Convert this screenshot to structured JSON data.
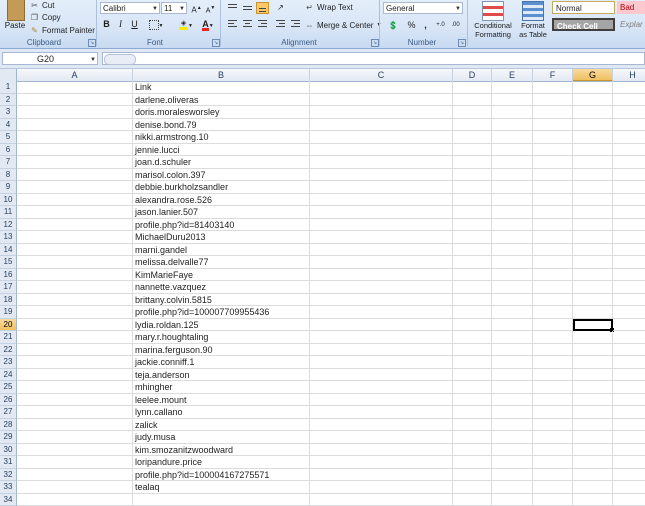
{
  "ribbon": {
    "clipboard": {
      "paste": "Paste",
      "cut": "Cut",
      "copy": "Copy",
      "format_painter": "Format Painter",
      "group_label": "Clipboard"
    },
    "font": {
      "family": "Calibri",
      "size": "11",
      "bold": "B",
      "italic": "I",
      "underline": "U",
      "group_label": "Font"
    },
    "alignment": {
      "wrap_text": "Wrap Text",
      "merge_center": "Merge & Center",
      "group_label": "Alignment"
    },
    "number": {
      "format": "General",
      "percent": "%",
      "comma": ",",
      "group_label": "Number"
    },
    "styles": {
      "conditional_formatting": "Conditional Formatting",
      "format_as_table": "Format as Table",
      "normal": "Normal",
      "bad": "Bad",
      "check_cell": "Check Cell",
      "explanatory": "Explar"
    }
  },
  "formula_bar": {
    "name_box": "G20",
    "formula": ""
  },
  "columns": [
    "A",
    "B",
    "C",
    "D",
    "E",
    "F",
    "G",
    "H"
  ],
  "selected_column": "G",
  "selected_row": 20,
  "rows": [
    {
      "n": "1",
      "b": "Link"
    },
    {
      "n": "2",
      "b": "darlene.oliveras"
    },
    {
      "n": "3",
      "b": "doris.moralesworsley"
    },
    {
      "n": "4",
      "b": "denise.bond.79"
    },
    {
      "n": "5",
      "b": "nikki.armstrong.10"
    },
    {
      "n": "6",
      "b": "jennie.lucci"
    },
    {
      "n": "7",
      "b": "joan.d.schuler"
    },
    {
      "n": "8",
      "b": "marisol.colon.397"
    },
    {
      "n": "9",
      "b": "debbie.burkholzsandler"
    },
    {
      "n": "10",
      "b": "alexandra.rose.526"
    },
    {
      "n": "11",
      "b": "jason.lanier.507"
    },
    {
      "n": "12",
      "b": "profile.php?id=81403140"
    },
    {
      "n": "13",
      "b": "MichaelDuru2013"
    },
    {
      "n": "14",
      "b": "marni.gandel"
    },
    {
      "n": "15",
      "b": "melissa.delvalle77"
    },
    {
      "n": "16",
      "b": "KimMarieFaye"
    },
    {
      "n": "17",
      "b": "nannette.vazquez"
    },
    {
      "n": "18",
      "b": "brittany.colvin.5815"
    },
    {
      "n": "19",
      "b": "profile.php?id=100007709955436"
    },
    {
      "n": "20",
      "b": "lydia.roldan.125"
    },
    {
      "n": "21",
      "b": "mary.r.houghtaling"
    },
    {
      "n": "22",
      "b": "marina.ferguson.90"
    },
    {
      "n": "23",
      "b": "jackie.conniff.1"
    },
    {
      "n": "24",
      "b": "teja.anderson"
    },
    {
      "n": "25",
      "b": "mhingher"
    },
    {
      "n": "26",
      "b": "leelee.mount"
    },
    {
      "n": "27",
      "b": "lynn.callano"
    },
    {
      "n": "28",
      "b": "zalick"
    },
    {
      "n": "29",
      "b": "judy.musa"
    },
    {
      "n": "30",
      "b": "kim.smozanitzwoodward"
    },
    {
      "n": "31",
      "b": "loripandure.price"
    },
    {
      "n": "32",
      "b": "profile.php?id=100004167275571"
    },
    {
      "n": "33",
      "b": "tealaq"
    },
    {
      "n": "34",
      "b": ""
    }
  ],
  "colors": {
    "ribbon_bg": "#d7e5f6",
    "selection_header": "#f1c15f",
    "normal_style": "#ffffff",
    "bad_style": "#ffc7ce",
    "check_cell_style": "#a5a5a5"
  }
}
